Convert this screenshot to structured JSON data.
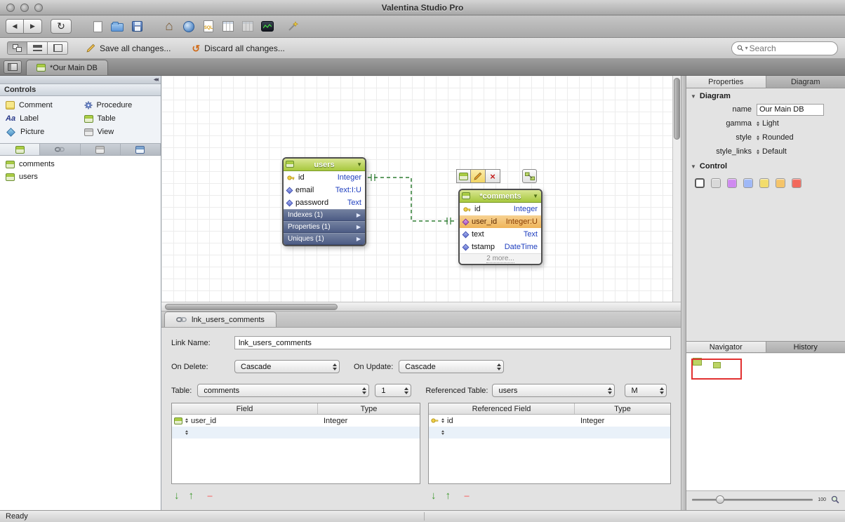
{
  "window": {
    "title": "Valentina Studio Pro",
    "status": "Ready"
  },
  "icons": {
    "back": "◀",
    "forward": "▶",
    "refresh": "↻",
    "home": "⌂",
    "collapse": "◀◀",
    "header_arrow": "▼",
    "section_arrow": "▶",
    "disclosure": "▼",
    "search_caret": "▾",
    "sql_label": "SQL",
    "delete_x": "×",
    "discard": "↺",
    "label_aa": "Aa",
    "down_arrow": "↓",
    "up_arrow": "↑",
    "remove": "−"
  },
  "actionbar": {
    "save_all": "Save all changes...",
    "discard_all": "Discard all changes...",
    "search_placeholder": "Search"
  },
  "tabbar": {
    "document_tab": "*Our Main DB"
  },
  "sidebar": {
    "controls_header": "Controls",
    "controls": [
      {
        "label": "Comment"
      },
      {
        "label": "Procedure"
      },
      {
        "label": "Label"
      },
      {
        "label": "Table"
      },
      {
        "label": "Picture"
      },
      {
        "label": "View"
      }
    ],
    "tables": [
      "comments",
      "users"
    ]
  },
  "diagram": {
    "users": {
      "title": "users",
      "fields": [
        {
          "name": "id",
          "type": "Integer"
        },
        {
          "name": "email",
          "type": "Text:I:U"
        },
        {
          "name": "password",
          "type": "Text"
        }
      ],
      "sections": [
        "Indexes (1)",
        "Properties (1)",
        "Uniques (1)"
      ]
    },
    "comments": {
      "title": "*comments",
      "fields": [
        {
          "name": "id",
          "type": "Integer"
        },
        {
          "name": "user_id",
          "type": "Integer:U"
        },
        {
          "name": "text",
          "type": "Text"
        },
        {
          "name": "tstamp",
          "type": "DateTime"
        }
      ],
      "more": "2 more..."
    }
  },
  "link_editor": {
    "tab_label": "lnk_users_comments",
    "link_name_label": "Link Name:",
    "link_name_value": "lnk_users_comments",
    "on_delete_label": "On Delete:",
    "on_delete_value": "Cascade",
    "on_update_label": "On Update:",
    "on_update_value": "Cascade",
    "table_label": "Table:",
    "table_value": "comments",
    "table_cardinality": "1",
    "ref_table_label": "Referenced Table:",
    "ref_table_value": "users",
    "ref_cardinality": "M",
    "fields_table": {
      "headers": [
        "Field",
        "Type"
      ],
      "rows": [
        {
          "field": "user_id",
          "type": "Integer"
        }
      ]
    },
    "ref_fields_table": {
      "headers": [
        "Referenced Field",
        "Type"
      ],
      "rows": [
        {
          "field": "id",
          "type": "Integer"
        }
      ]
    }
  },
  "properties": {
    "tabs": [
      "Properties",
      "Diagram"
    ],
    "diagram_section": "Diagram",
    "name_label": "name",
    "name_value": "Our Main DB",
    "gamma_label": "gamma",
    "gamma_value": "Light",
    "style_label": "style",
    "style_value": "Rounded",
    "style_links_label": "style_links",
    "style_links_value": "Default",
    "control_section": "Control",
    "swatches": [
      "#ffffff",
      "#d9d9d9",
      "#cf8af0",
      "#9fb8f7",
      "#f2dc6b",
      "#f5c469",
      "#f2695c"
    ]
  },
  "navigator": {
    "tabs": [
      "Navigator",
      "History"
    ],
    "zoom_value": "100"
  }
}
